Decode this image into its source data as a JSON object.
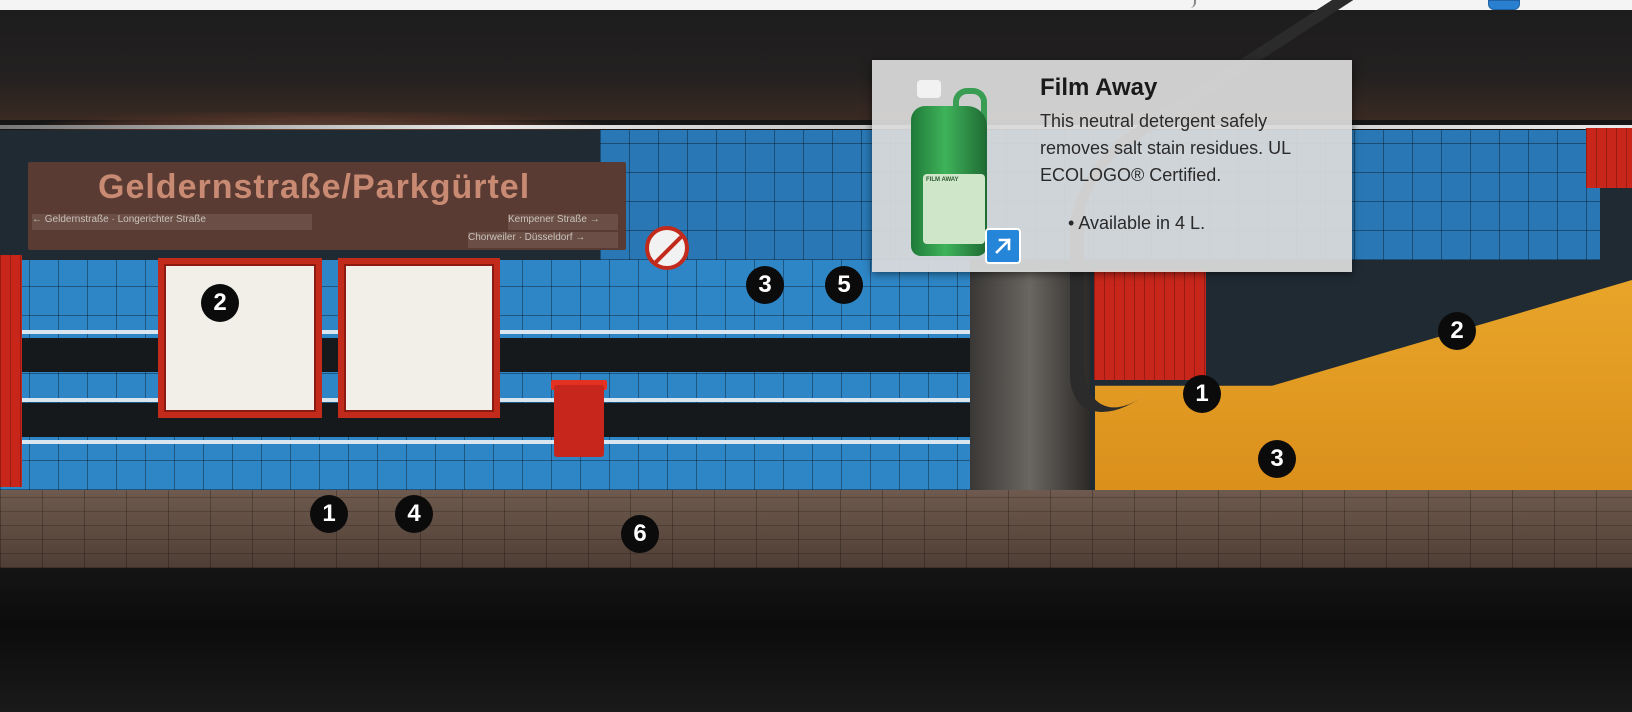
{
  "popup": {
    "title": "Film Away",
    "description": "This neutral detergent safely removes salt stain residues. UL ECOLOGO® Certified.",
    "bullets": [
      "Available in 4 L."
    ],
    "link_icon": "external-link-icon",
    "product_label": "FILM AWAY"
  },
  "sign": {
    "title": "Geldernstraße/Parkgürtel",
    "row1_left": "← Geldernstraße · Longerichter Straße",
    "row1_right": "Kempener Straße →",
    "row2_right": "Chorweiler · Düsseldorf →"
  },
  "hotspots": [
    {
      "id": "h1-floor",
      "label": "1"
    },
    {
      "id": "h2-board",
      "label": "2"
    },
    {
      "id": "h3-wall",
      "label": "3"
    },
    {
      "id": "h4-floor",
      "label": "4"
    },
    {
      "id": "h5-wall",
      "label": "5"
    },
    {
      "id": "h6-floor",
      "label": "6"
    },
    {
      "id": "h1-handrail",
      "label": "1"
    },
    {
      "id": "h2-escalator",
      "label": "2"
    },
    {
      "id": "h3-panel",
      "label": "3"
    }
  ],
  "colors": {
    "hotspot_bg": "#0b0b0b",
    "accent_blue": "#2585d8",
    "tile_blue": "#2e86c6",
    "escalator_orange": "#e8a52a",
    "frame_red": "#c22a1c"
  }
}
